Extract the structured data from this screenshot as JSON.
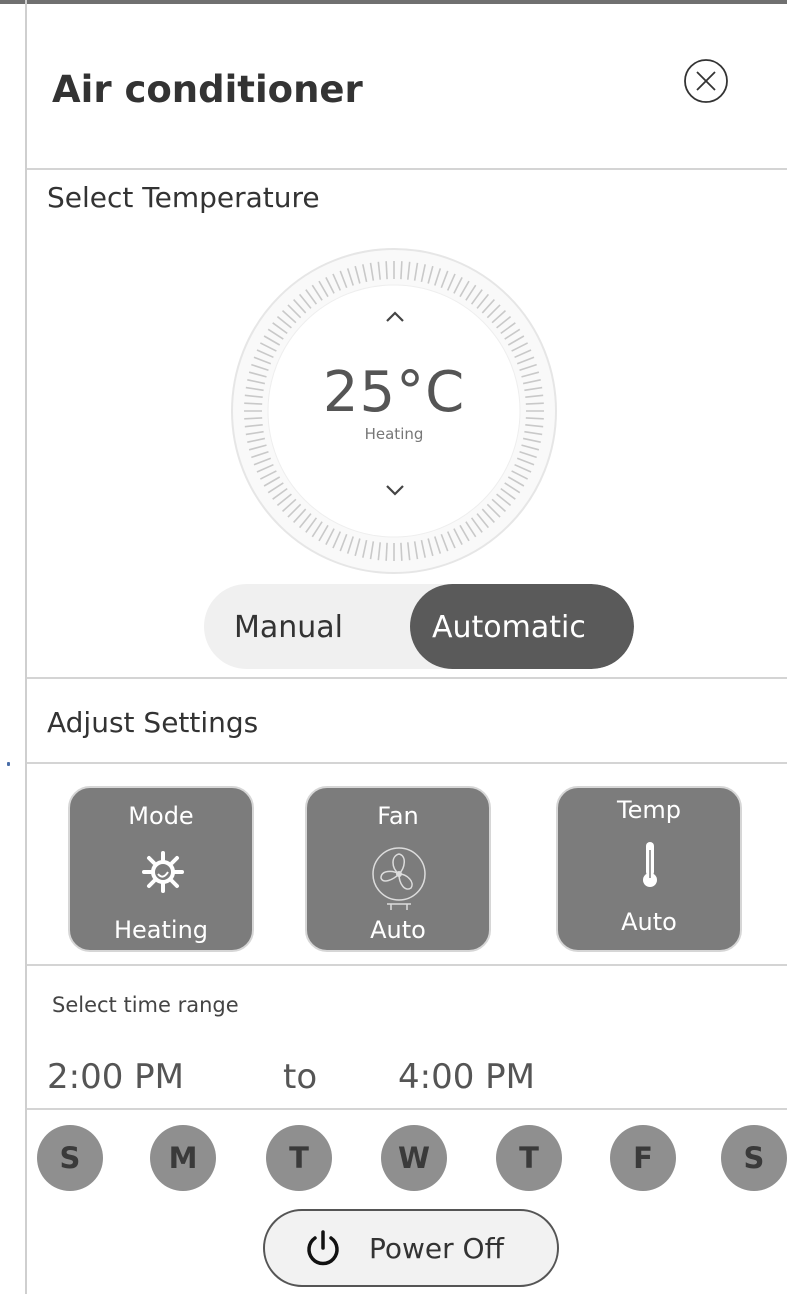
{
  "header": {
    "title": "Air conditioner",
    "close_icon": "close-circle-icon"
  },
  "temperature": {
    "section_label": "Select Temperature",
    "value": "25°C",
    "mode": "Heating",
    "up_icon": "chevron-up-icon",
    "down_icon": "chevron-down-icon"
  },
  "control_mode": {
    "options": [
      "Manual",
      "Automatic"
    ],
    "selected": "Automatic"
  },
  "settings": {
    "section_label": "Adjust   Settings",
    "tiles": [
      {
        "label": "Mode",
        "value": "Heating",
        "icon": "sun-icon"
      },
      {
        "label": "Fan",
        "value": "Auto",
        "icon": "fan-icon"
      },
      {
        "label": "Temp",
        "value": "Auto",
        "icon": "thermometer-icon"
      }
    ]
  },
  "time_range": {
    "label": "Select time range",
    "start": "2:00 PM",
    "separator": "to",
    "end": "4:00 PM"
  },
  "days": [
    "S",
    "M",
    "T",
    "W",
    "T",
    "F",
    "S"
  ],
  "power": {
    "label": "Power Off",
    "icon": "power-icon"
  },
  "colors": {
    "tile_bg": "#7c7c7c",
    "toggle_active": "#5a5a5a",
    "day_bg": "#8f8f8f"
  }
}
